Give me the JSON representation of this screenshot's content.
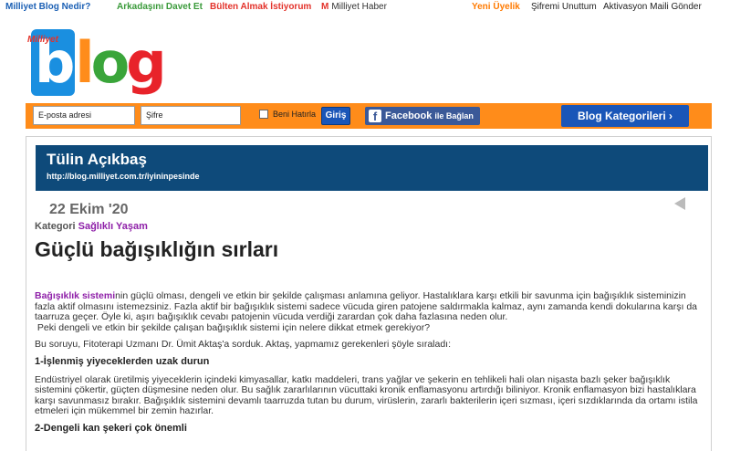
{
  "topbar": {
    "links": [
      "Milliyet Blog Nedir?",
      "Arkadaşını Davet Et",
      "Bülten Almak İstiyorum",
      "Milliyet Haber"
    ],
    "milliyet_mark": "M",
    "right_links": [
      "Yeni Üyelik",
      "Şifremi Unuttum",
      "Aktivasyon Maili Gönder"
    ]
  },
  "logo": {
    "brand": "Milliyet",
    "b": "b",
    "l": "l",
    "o": "o",
    "g": "g"
  },
  "login": {
    "email_placeholder": "E-posta adresi",
    "password_placeholder": "Şifre",
    "remember_label": "Beni Hatırla",
    "submit_label": "Giriş",
    "facebook_label": "Facebook",
    "facebook_suffix": "ile Bağlan",
    "categories_label": "Blog Kategorileri ›"
  },
  "blog": {
    "name": "Tülin Açıkbaş",
    "url": "http://blog.milliyet.com.tr/iyininpesinde"
  },
  "post": {
    "date": "22 Ekim '20",
    "category_label": "Kategori",
    "category_value": "Sağlıklı Yaşam",
    "title": "Güçlü bağışıklığın sırları",
    "intro_link": "Bağışıklık sistemi",
    "intro_rest": "nin güçlü olması, dengeli ve etkin bir şekilde çalışması anlamına geliyor. Hastalıklara karşı etkili bir savunma için bağışıklık sisteminizin fazla aktif olmasını istemezsiniz. Fazla aktif bir bağışıklık sistemi sadece vücuda giren patojene saldırmakla kalmaz, aynı zamanda kendi dokularına karşı da taarruza geçer. Öyle ki, aşırı bağışıklık cevabı patojenin vücuda verdiği zarardan çok daha fazlasına neden olur.",
    "intro_question": "Peki dengeli ve etkin bir şekilde çalışan bağışıklık sistemi için nelere dikkat etmek gerekiyor?",
    "para2": "Bu soruyu, Fitoterapi Uzmanı Dr. Ümit Aktaş'a sorduk. Aktaş, yapmamız gerekenleri şöyle sıraladı:",
    "heading1": "1-İşlenmiş yiyeceklerden uzak durun",
    "para3": "Endüstriyel olarak üretilmiş yiyeceklerin içindeki kimyasallar, katkı maddeleri, trans yağlar ve şekerin en tehlikeli hali olan nişasta bazlı şeker bağışıklık sistemini çökertir, güçten düşmesine neden olur. Bu sağlık zararlılarının vücuttaki kronik enflamasyonu artırdığı biliniyor. Kronik enflamasyon bizi hastalıklara karşı savunmasız bırakır. Bağışıklık sistemini devamlı taarruzda tutan bu durum, virüslerin, zararlı bakterilerin içeri sızması, içeri sızdıklarında da ortamı istila etmeleri için mükemmel bir zemin hazırlar.",
    "heading2": "2-Dengeli kan şekeri çok önemli"
  }
}
